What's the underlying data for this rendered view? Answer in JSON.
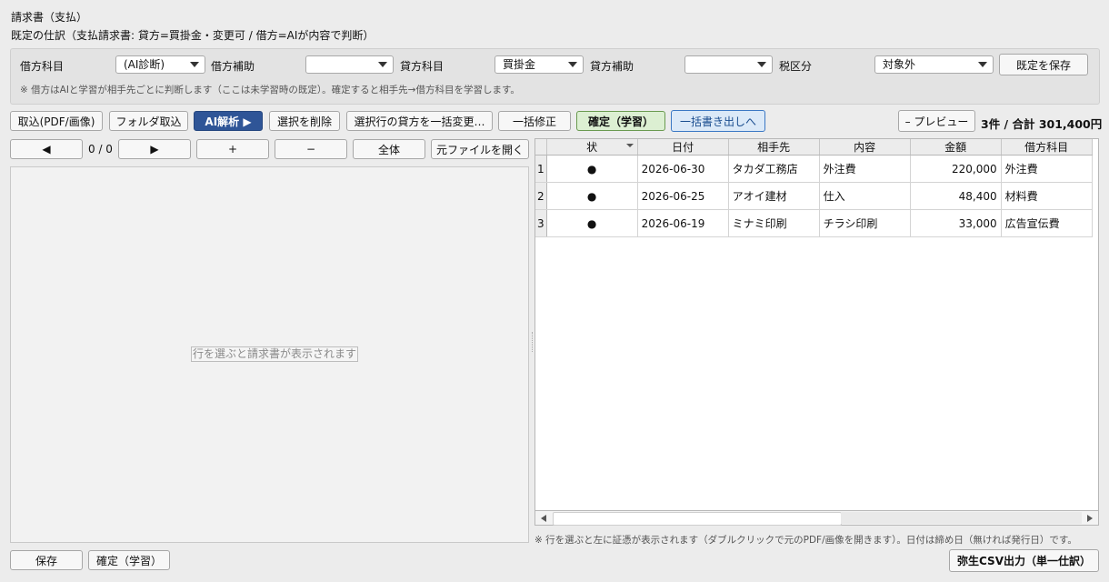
{
  "header": {
    "title": "請求書（支払）",
    "subtitle": "既定の仕訳（支払請求書: 貸方=買掛金・変更可 / 借方=AIが内容で判断）"
  },
  "defaults": {
    "debit_account_label": "借方科目",
    "debit_account_value": "(AI診断)",
    "debit_sub_label": "借方補助",
    "debit_sub_value": "",
    "credit_account_label": "貸方科目",
    "credit_account_value": "買掛金",
    "credit_sub_label": "貸方補助",
    "credit_sub_value": "",
    "tax_label": "税区分",
    "tax_value": "対象外",
    "save_defaults_label": "既定を保存",
    "note": "※ 借方はAIと学習が相手先ごとに判断します（ここは未学習時の既定）。確定すると相手先→借方科目を学習します。"
  },
  "toolbar": {
    "import_label": "取込(PDF/画像)",
    "folder_import_label": "フォルダ取込",
    "ai_analyze_label": "AI解析 ▶",
    "delete_selected_label": "選択を削除",
    "bulk_change_credit_label": "選択行の貸方を一括変更…",
    "bulk_fix_label": "一括修正",
    "confirm_learn_label": "確定（学習）",
    "bulk_export_label": "一括書き出しへ",
    "preview_label": "– プレビュー",
    "summary": "3件 / 合計 301,400円"
  },
  "viewer_nav": {
    "prev_label": "◀",
    "page_indicator": "0 / 0",
    "next_label": "▶",
    "zoom_in_label": "+",
    "zoom_out_label": "−",
    "fit_label": "全体",
    "open_original_label": "元ファイルを開く",
    "placeholder": "行を選ぶと請求書が表示されます"
  },
  "table": {
    "columns": [
      "状",
      "日付",
      "相手先",
      "内容",
      "金額",
      "借方科目"
    ],
    "rows": [
      {
        "num": "1",
        "status": "●",
        "date": "2026-06-30",
        "vendor": "タカダ工務店",
        "content": "外注費",
        "amount": "220,000",
        "debit": "外注費"
      },
      {
        "num": "2",
        "status": "●",
        "date": "2026-06-25",
        "vendor": "アオイ建材",
        "content": "仕入",
        "amount": "48,400",
        "debit": "材料費"
      },
      {
        "num": "3",
        "status": "●",
        "date": "2026-06-19",
        "vendor": "ミナミ印刷",
        "content": "チラシ印刷",
        "amount": "33,000",
        "debit": "広告宣伝費"
      }
    ],
    "note": "※ 行を選ぶと左に証憑が表示されます（ダブルクリックで元のPDF/画像を開きます）。日付は締め日（無ければ発行日）です。"
  },
  "footer": {
    "save_label": "保存",
    "confirm_learn_label": "確定（学習）",
    "export_csv_label": "弥生CSV出力（単一仕訳）"
  }
}
